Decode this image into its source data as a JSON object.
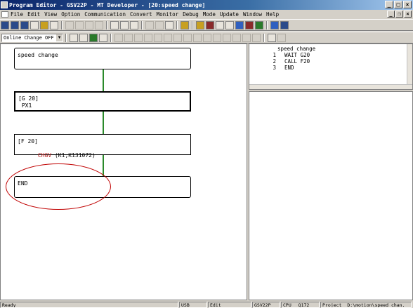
{
  "window": {
    "title": "Program Editor - GSV22P - MT Developer - [20:speed change]"
  },
  "menu": [
    "File",
    "Edit",
    "View",
    "Option",
    "Communication",
    "Convert",
    "Monitor",
    "Debug",
    "Mode",
    "Update",
    "Window",
    "Help"
  ],
  "toolbar": {
    "online_change": "Online Change OFF"
  },
  "program": {
    "blocks": [
      {
        "line1": "speed change",
        "line2": ""
      },
      {
        "line1": "[G  20]",
        "line2": " PX1"
      },
      {
        "line1": "[F  20]",
        "line2": "CHGV",
        "line2b": " (K1,K131072)"
      },
      {
        "line1": "END",
        "line2": ""
      }
    ]
  },
  "listing": {
    "header": "speed change",
    "rows": [
      {
        "num": "1",
        "text": "WAIT G20"
      },
      {
        "num": "2",
        "text": "CALL F20"
      },
      {
        "num": "3",
        "text": "END"
      }
    ]
  },
  "status": {
    "ready": "Ready",
    "usb": "USB",
    "mode": "Edit",
    "model": "GSV22P",
    "cpu_label": "CPU",
    "cpu": "Q172",
    "project_label": "Project",
    "project": "D:\\motion\\speed chan."
  }
}
